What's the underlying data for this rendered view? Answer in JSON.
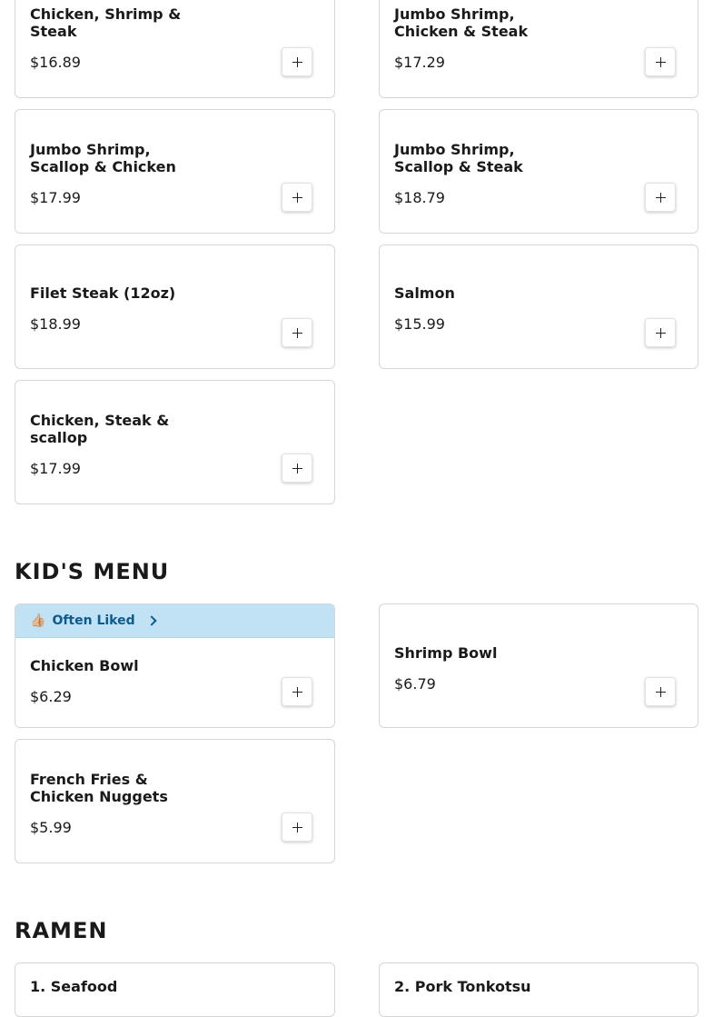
{
  "add_icon": "plus-icon",
  "often_liked": {
    "icon": "thumbs-up-icon",
    "glyph": "👍🏼",
    "label": "Often Liked",
    "color": "#c1e2f5"
  },
  "sections": {
    "kids": {
      "title": "KID'S MENU"
    },
    "ramen": {
      "title": "RAMEN"
    }
  },
  "items": {
    "chicken_shrimp_steak": {
      "name": "Chicken, Shrimp & Steak",
      "price": "$16.89"
    },
    "jumbo_shrimp_chicken_steak": {
      "name": "Jumbo Shrimp, Chicken & Steak",
      "price": "$17.29"
    },
    "jumbo_shrimp_scallop_chicken": {
      "name": "Jumbo Shrimp, Scallop & Chicken",
      "price": "$17.99"
    },
    "jumbo_shrimp_scallop_steak": {
      "name": "Jumbo Shrimp, Scallop & Steak",
      "price": "$18.79"
    },
    "filet_steak": {
      "name": "Filet Steak (12oz)",
      "price": "$18.99"
    },
    "salmon": {
      "name": "Salmon",
      "price": "$15.99"
    },
    "chicken_steak_scallop": {
      "name": "Chicken, Steak & scallop",
      "price": "$17.99"
    },
    "chicken_bowl": {
      "name": "Chicken Bowl",
      "price": "$6.29"
    },
    "shrimp_bowl": {
      "name": "Shrimp Bowl",
      "price": "$6.79"
    },
    "fries_nuggets": {
      "name": "French Fries & Chicken Nuggets",
      "price": "$5.99"
    },
    "seafood_ramen": {
      "name": "1. Seafood"
    },
    "pork_tonkotsu": {
      "name": "2. Pork Tonkotsu"
    }
  }
}
